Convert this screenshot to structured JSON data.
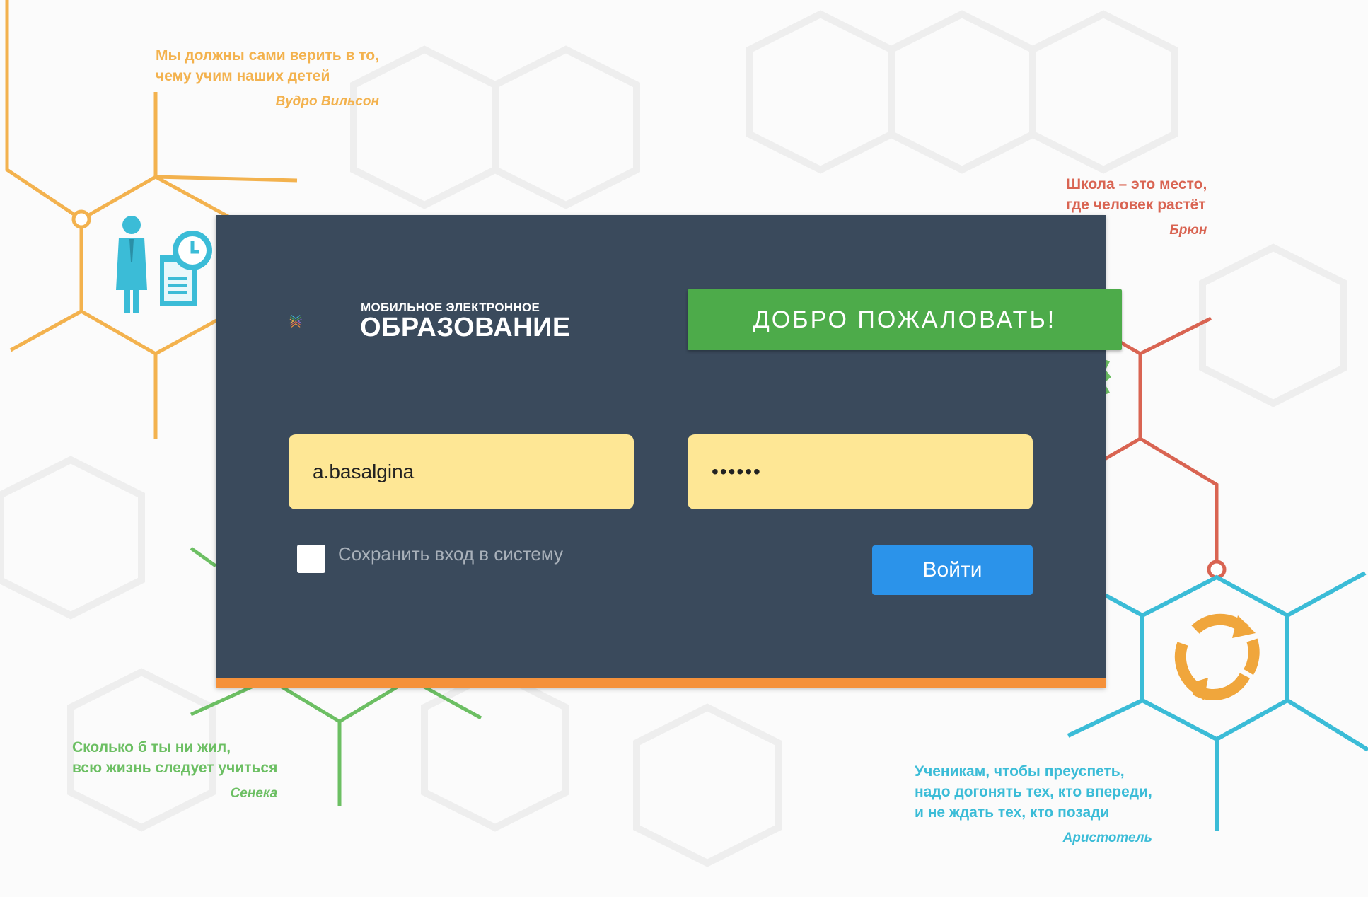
{
  "quotes": [
    {
      "lines": [
        "Мы должны сами верить в то,",
        "чему учим наших детей"
      ],
      "author": "Вудро Вильсон"
    },
    {
      "lines": [
        "Школа – это место,",
        "где человек растёт"
      ],
      "author": "Брюн"
    },
    {
      "lines": [
        "Сколько б ты ни жил,",
        "всю жизнь следует учиться"
      ],
      "author": "Сенека"
    },
    {
      "lines": [
        "Ученикам, чтобы преуспеть,",
        "надо догонять тех, кто впереди,",
        "и не ждать тех, кто позади"
      ],
      "author": "Аристотель"
    }
  ],
  "logo": {
    "small": "МОБИЛЬНОЕ ЭЛЕКТРОННОЕ",
    "big": "ОБРАЗОВАНИЕ"
  },
  "welcome": "ДОБРО ПОЖАЛОВАТЬ!",
  "form": {
    "login_value": "a.basalgina",
    "password_value": "••••••",
    "remember_label": "Сохранить вход в систему",
    "submit_label": "Войти"
  },
  "colors": {
    "panel": "#3a4a5c",
    "accent_bar": "#f5913a",
    "welcome": "#4dab4a",
    "button": "#2b93ea",
    "field": "#fee795"
  },
  "icons": [
    "teacher-document-icon",
    "refresh-icon",
    "green-decor-icon"
  ]
}
